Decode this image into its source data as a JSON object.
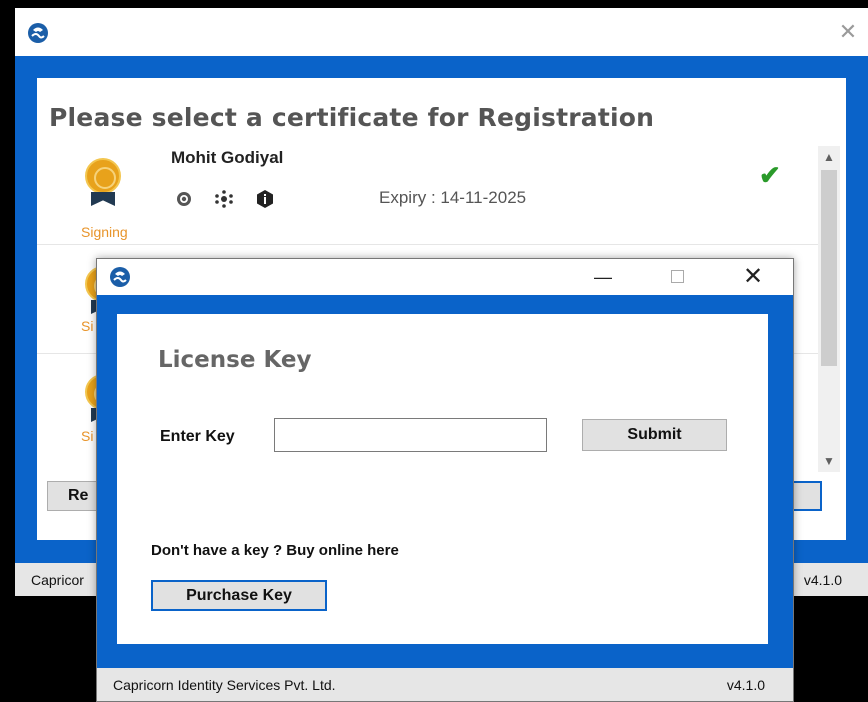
{
  "background_window": {
    "heading": "Please select a certificate for Registration",
    "certificates": [
      {
        "name": "Mohit Godiyal",
        "type_label": "Signing",
        "expiry": "Expiry : 14-11-2025",
        "selected": true
      },
      {
        "name": "",
        "type_label": "Si",
        "expiry": ""
      },
      {
        "name": "",
        "type_label": "Si",
        "expiry": ""
      }
    ],
    "left_button_label": "Re",
    "status_left": "Capricor",
    "status_right": "v4.1.0"
  },
  "dialog": {
    "title": "License Key",
    "enter_key_label": "Enter Key",
    "key_value": "",
    "submit_label": "Submit",
    "buy_text": "Don't have a key ? Buy online here",
    "purchase_label": "Purchase Key",
    "status_left": "Capricorn Identity Services Pvt. Ltd.",
    "status_right": "v4.1.0",
    "minimize_glyph": "—",
    "close_glyph": "✕"
  },
  "colors": {
    "brand_blue": "#0a63c9",
    "check_green": "#2a9a2a",
    "signing_orange": "#e8942a",
    "medal_gold": "#e8a21b"
  },
  "icons": {
    "app_logo": "capricorn-logo-icon",
    "cert_actions": [
      "gear-icon",
      "network-icon",
      "info-icon"
    ],
    "selected": "checkmark-icon"
  }
}
